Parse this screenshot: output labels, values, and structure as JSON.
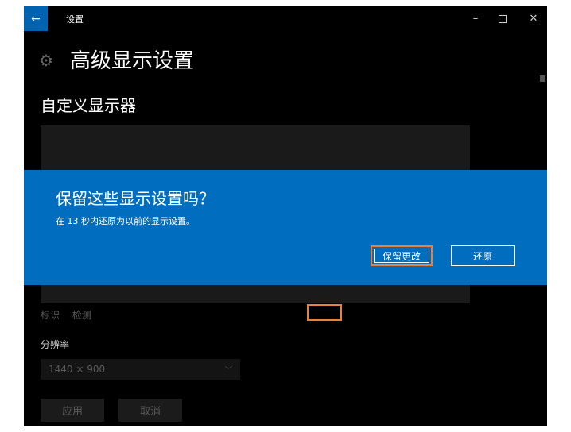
{
  "window": {
    "title": "设置",
    "back_glyph": "←",
    "minimize_glyph": "–",
    "close_glyph": "✕"
  },
  "header": {
    "icon": "gear-icon",
    "title": "高级显示设置"
  },
  "section": {
    "title": "自定义显示器"
  },
  "links": {
    "identify": "标识",
    "detect": "检测"
  },
  "resolution": {
    "label": "分辨率",
    "value": "1440 × 900"
  },
  "buttons": {
    "apply": "应用",
    "cancel": "取消"
  },
  "dialog": {
    "title": "保留这些显示设置吗？",
    "message": "在 13 秒内还原为以前的显示设置。",
    "keep_label": "保留更改",
    "revert_label": "还原"
  },
  "colors": {
    "accent": "#006dbe",
    "titlebar_back": "#0063b1",
    "highlight": "#e8823a"
  }
}
